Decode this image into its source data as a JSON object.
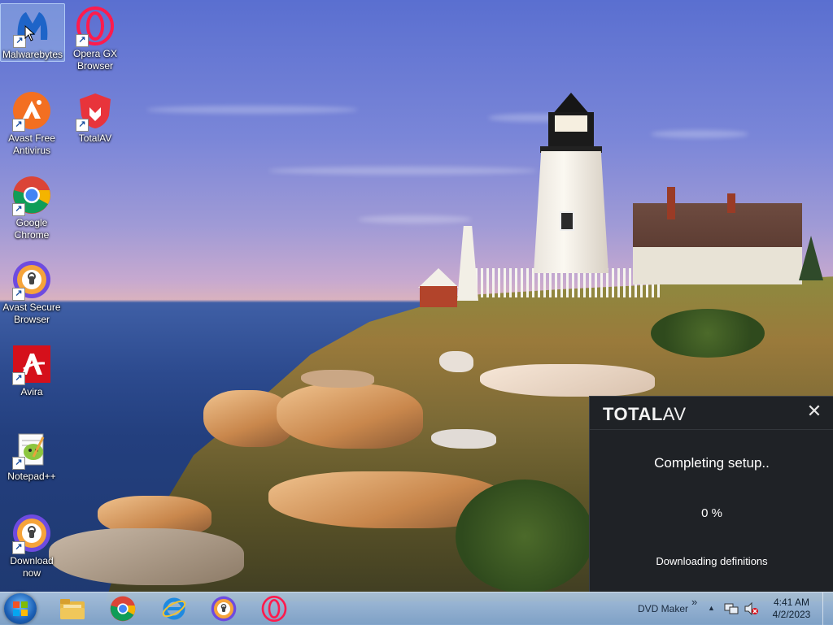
{
  "desktop": {
    "icons": [
      {
        "label": "Malwarebytes",
        "icon": "malwarebytes-icon"
      },
      {
        "label": "Opera GX Browser",
        "icon": "opera-gx-icon"
      },
      {
        "label": "Avast Free Antivirus",
        "icon": "avast-icon"
      },
      {
        "label": "TotalAV",
        "icon": "totalav-icon"
      },
      {
        "label": "Google Chrome",
        "icon": "chrome-icon"
      },
      {
        "label": "Avast Secure Browser",
        "icon": "avast-secure-browser-icon"
      },
      {
        "label": "Avira",
        "icon": "avira-icon"
      },
      {
        "label": "Notepad++",
        "icon": "notepad-plus-plus-icon"
      },
      {
        "label": "Download now",
        "icon": "avast-secure-browser-icon"
      }
    ]
  },
  "totalav": {
    "logo_bold": "TOTAL",
    "logo_light": "AV",
    "close_glyph": "✕",
    "title": "Completing setup..",
    "progress_text": "0 %",
    "progress": 0,
    "status": "Downloading definitions"
  },
  "taskbar": {
    "pinned": [
      "windows-explorer-icon",
      "chrome-icon",
      "internet-explorer-icon",
      "avast-secure-browser-icon",
      "opera-icon"
    ],
    "toolbar_label": "DVD Maker",
    "toolbar_chevron": "»",
    "tray_arrow": "▲",
    "time": "4:41 AM",
    "date": "4/2/2023"
  },
  "colors": {
    "totalav_bg": "#1f2226",
    "taskbar": "#9fbbdc",
    "avast_orange": "#f36f21",
    "totalav_red": "#e8343b",
    "avira_red": "#d5101b"
  }
}
